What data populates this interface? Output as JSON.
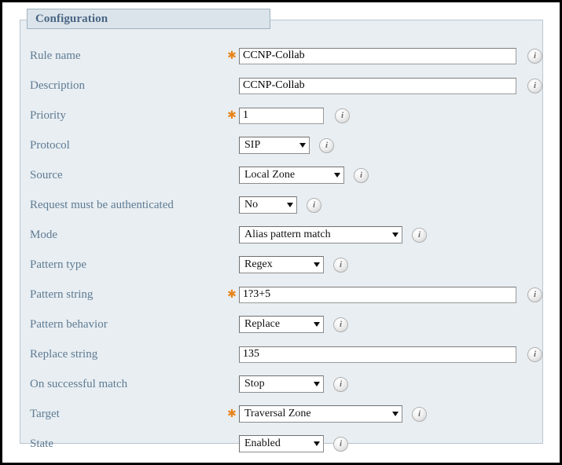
{
  "panel": {
    "legend": "Configuration"
  },
  "icons": {
    "info": "i",
    "required_star": "✱"
  },
  "colors": {
    "panel_background": "#e8eef2",
    "legend_background": "#dbe4ea",
    "legend_text": "#4a6584",
    "label_text": "#5f7b93",
    "required_star": "#e8841a",
    "border": "#b9c6d0"
  },
  "rows": [
    {
      "label": "Rule name",
      "required": true,
      "control": "text",
      "size": "wide",
      "value": "CCNP-Collab",
      "name": "rule-name"
    },
    {
      "label": "Description",
      "required": false,
      "control": "text",
      "size": "wide",
      "value": "CCNP-Collab",
      "name": "description"
    },
    {
      "label": "Priority",
      "required": true,
      "control": "text",
      "size": "small",
      "value": "1",
      "name": "priority"
    },
    {
      "label": "Protocol",
      "required": false,
      "control": "select",
      "size": "w-xs",
      "value": "SIP",
      "name": "protocol"
    },
    {
      "label": "Source",
      "required": false,
      "control": "select",
      "size": "w-lg",
      "value": "Local Zone",
      "name": "source"
    },
    {
      "label": "Request must be authenticated",
      "required": false,
      "control": "select",
      "size": "w-sm",
      "value": "No",
      "name": "request-must-be-authenticated"
    },
    {
      "label": "Mode",
      "required": false,
      "control": "select",
      "size": "w-xl",
      "value": "Alias pattern match",
      "name": "mode"
    },
    {
      "label": "Pattern type",
      "required": false,
      "control": "select",
      "size": "w-md",
      "value": "Regex",
      "name": "pattern-type"
    },
    {
      "label": "Pattern string",
      "required": true,
      "control": "text",
      "size": "wide",
      "value": "1?3+5",
      "name": "pattern-string"
    },
    {
      "label": "Pattern behavior",
      "required": false,
      "control": "select",
      "size": "w-md",
      "value": "Replace",
      "name": "pattern-behavior"
    },
    {
      "label": "Replace string",
      "required": false,
      "control": "text",
      "size": "wide",
      "value": "135",
      "name": "replace-string"
    },
    {
      "label": "On successful match",
      "required": false,
      "control": "select",
      "size": "w-md",
      "value": "Stop",
      "name": "on-successful-match"
    },
    {
      "label": "Target",
      "required": true,
      "control": "select",
      "size": "w-xl",
      "value": "Traversal Zone",
      "name": "target"
    },
    {
      "label": "State",
      "required": false,
      "control": "select",
      "size": "w-md",
      "value": "Enabled",
      "name": "state"
    }
  ]
}
